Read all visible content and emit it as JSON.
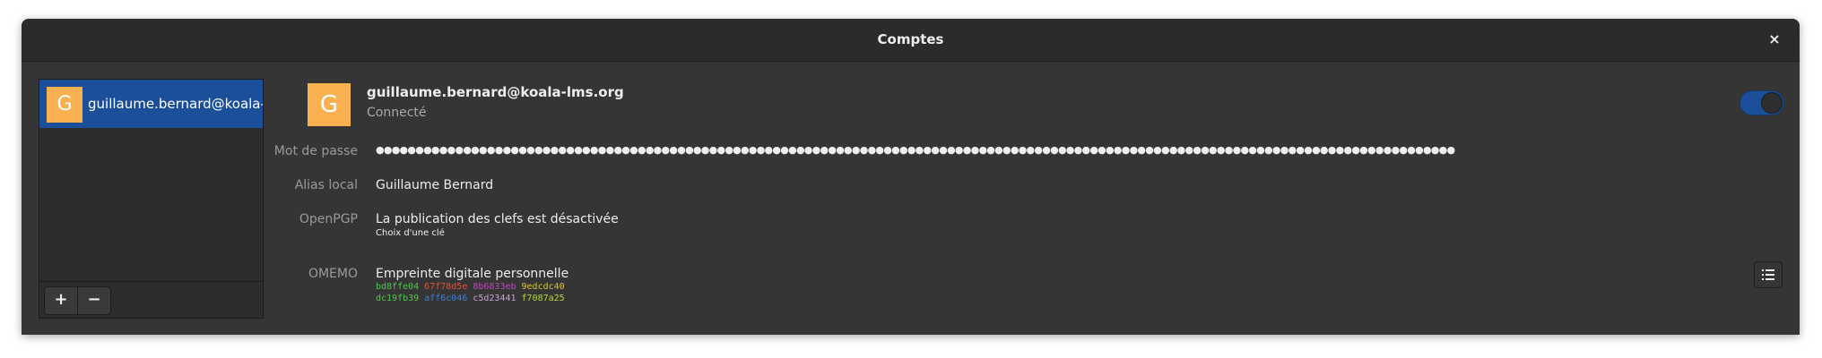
{
  "window": {
    "title": "Comptes",
    "close_label": "×"
  },
  "sidebar": {
    "accounts": [
      {
        "avatar_letter": "G",
        "label": "guillaume.bernard@koala-lms.org",
        "selected": true
      }
    ],
    "add_label": "+",
    "remove_label": "−"
  },
  "account": {
    "avatar_letter": "G",
    "jid": "guillaume.bernard@koala-lms.org",
    "status": "Connecté",
    "enabled": true,
    "password_label": "Mot de passe",
    "password_value": "●●●●●●●●●●●●●●●●●●●●●●●●●●●●●●●●●●●●●●●●●●●●●●●●●●●●●●●●●●●●●●●●●●●●●●●●●●●●●●●●●●●●●●●●●●●●●●●●●●●●●●●●●●●●●●●●●●●●●●●●●●●●●●●●●●●●●●●●",
    "alias_label": "Alias local",
    "alias_value": "Guillaume Bernard",
    "openpgp_label": "OpenPGP",
    "openpgp_value": "La publication des clefs est désactivée",
    "openpgp_link": "Choix d'une clé",
    "omemo_label": "OMEMO",
    "omemo_title": "Empreinte digitale personnelle",
    "fingerprint_row1": [
      "bd8ffe04",
      "67f78d5e",
      "8b6833eb",
      "9edcdc40"
    ],
    "fingerprint_row2": [
      "dc19fb39",
      "aff6c046",
      "c5d23441",
      "f7087a25"
    ]
  },
  "colors": {
    "accent": "#1b4f99",
    "avatar": "#f9b14f",
    "window_bg": "#353535",
    "titlebar_bg": "#2b2b2b"
  },
  "icons": {
    "close": "close-icon",
    "list": "list-icon",
    "add": "plus-icon",
    "remove": "minus-icon"
  }
}
